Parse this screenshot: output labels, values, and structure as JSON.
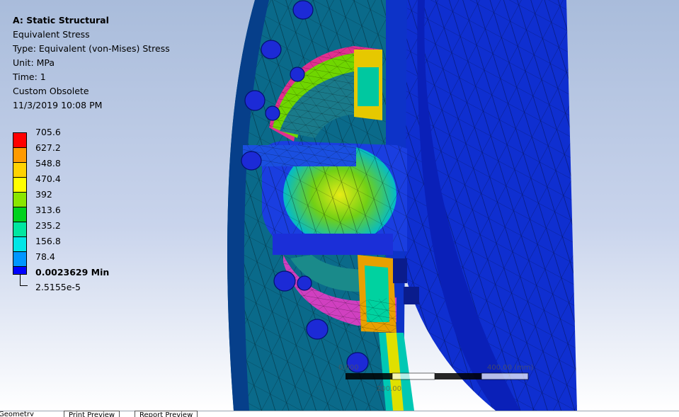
{
  "info": {
    "title": "A: Static Structural",
    "result": "Equivalent Stress",
    "type": "Type: Equivalent (von-Mises) Stress",
    "unit": "Unit: MPa",
    "time": "Time: 1",
    "custom": "Custom Obsolete",
    "date": "11/3/2019 10:08 PM"
  },
  "legend": {
    "bands": [
      {
        "label": "705.6",
        "color": "#ff0000"
      },
      {
        "label": "627.2",
        "color": "#ff9a00"
      },
      {
        "label": "548.8",
        "color": "#ffd200"
      },
      {
        "label": "470.4",
        "color": "#ffff00"
      },
      {
        "label": "392",
        "color": "#8ae600"
      },
      {
        "label": "313.6",
        "color": "#00d21e"
      },
      {
        "label": "235.2",
        "color": "#00e6a0"
      },
      {
        "label": "156.8",
        "color": "#00e6e6"
      },
      {
        "label": "78.4",
        "color": "#0096ff"
      },
      {
        "label": "0.0023629 Min",
        "color": "#0000ff"
      }
    ],
    "min_marker": "2.5155e-5"
  },
  "scale": {
    "label_left": "0.000",
    "label_mid": "200.00",
    "label_right": "400.00 (mm)"
  },
  "tabs": [
    {
      "label": "Geometry",
      "active": true
    },
    {
      "label": "Print Preview",
      "active": false
    },
    {
      "label": "Report Preview",
      "active": false
    }
  ]
}
